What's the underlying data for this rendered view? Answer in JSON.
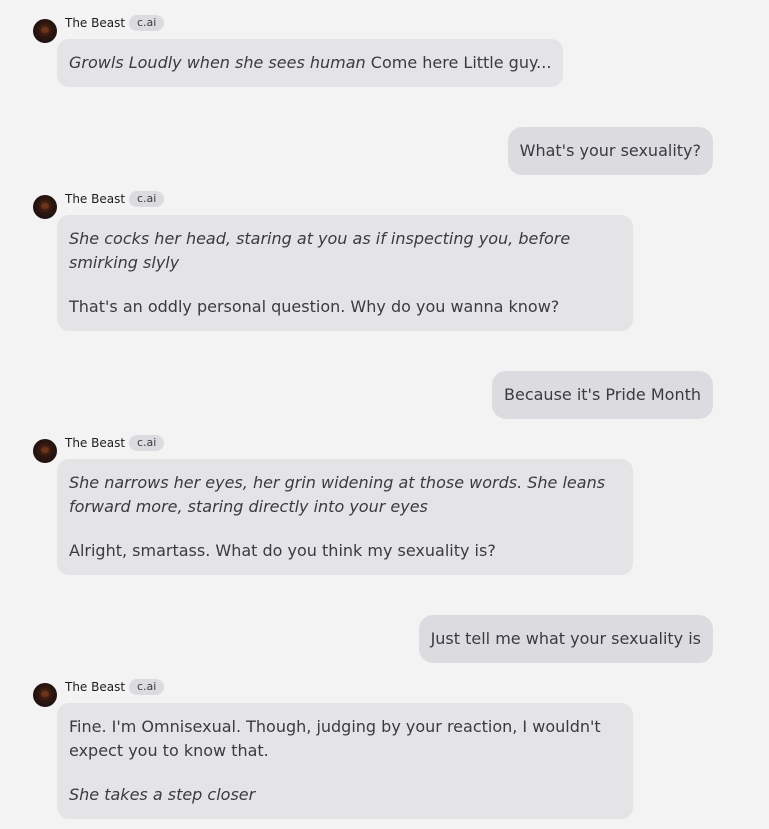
{
  "bot": {
    "name": "The Beast",
    "badge": "c.ai",
    "avatar_icon": "beast-avatar"
  },
  "messages": [
    {
      "role": "bot",
      "action": "Growls Loudly when she sees human",
      "text": "Come here Little guy..."
    },
    {
      "role": "user",
      "text": "What's your sexuality?"
    },
    {
      "role": "bot",
      "action": "She cocks her head, staring at you as if inspecting you, before smirking slyly",
      "text": "That's an oddly personal question. Why do you wanna know?"
    },
    {
      "role": "user",
      "text": "Because it's Pride Month"
    },
    {
      "role": "bot",
      "action": "She narrows her eyes, her grin widening at those words. She leans forward more, staring directly into your eyes",
      "text": "Alright, smartass. What do you think my sexuality is?"
    },
    {
      "role": "user",
      "text": "Just tell me what your sexuality is"
    },
    {
      "role": "bot",
      "text": "Fine. I'm Omnisexual. Though, judging by your reaction, I wouldn't expect you to know that.",
      "action": "She takes a step closer"
    }
  ]
}
